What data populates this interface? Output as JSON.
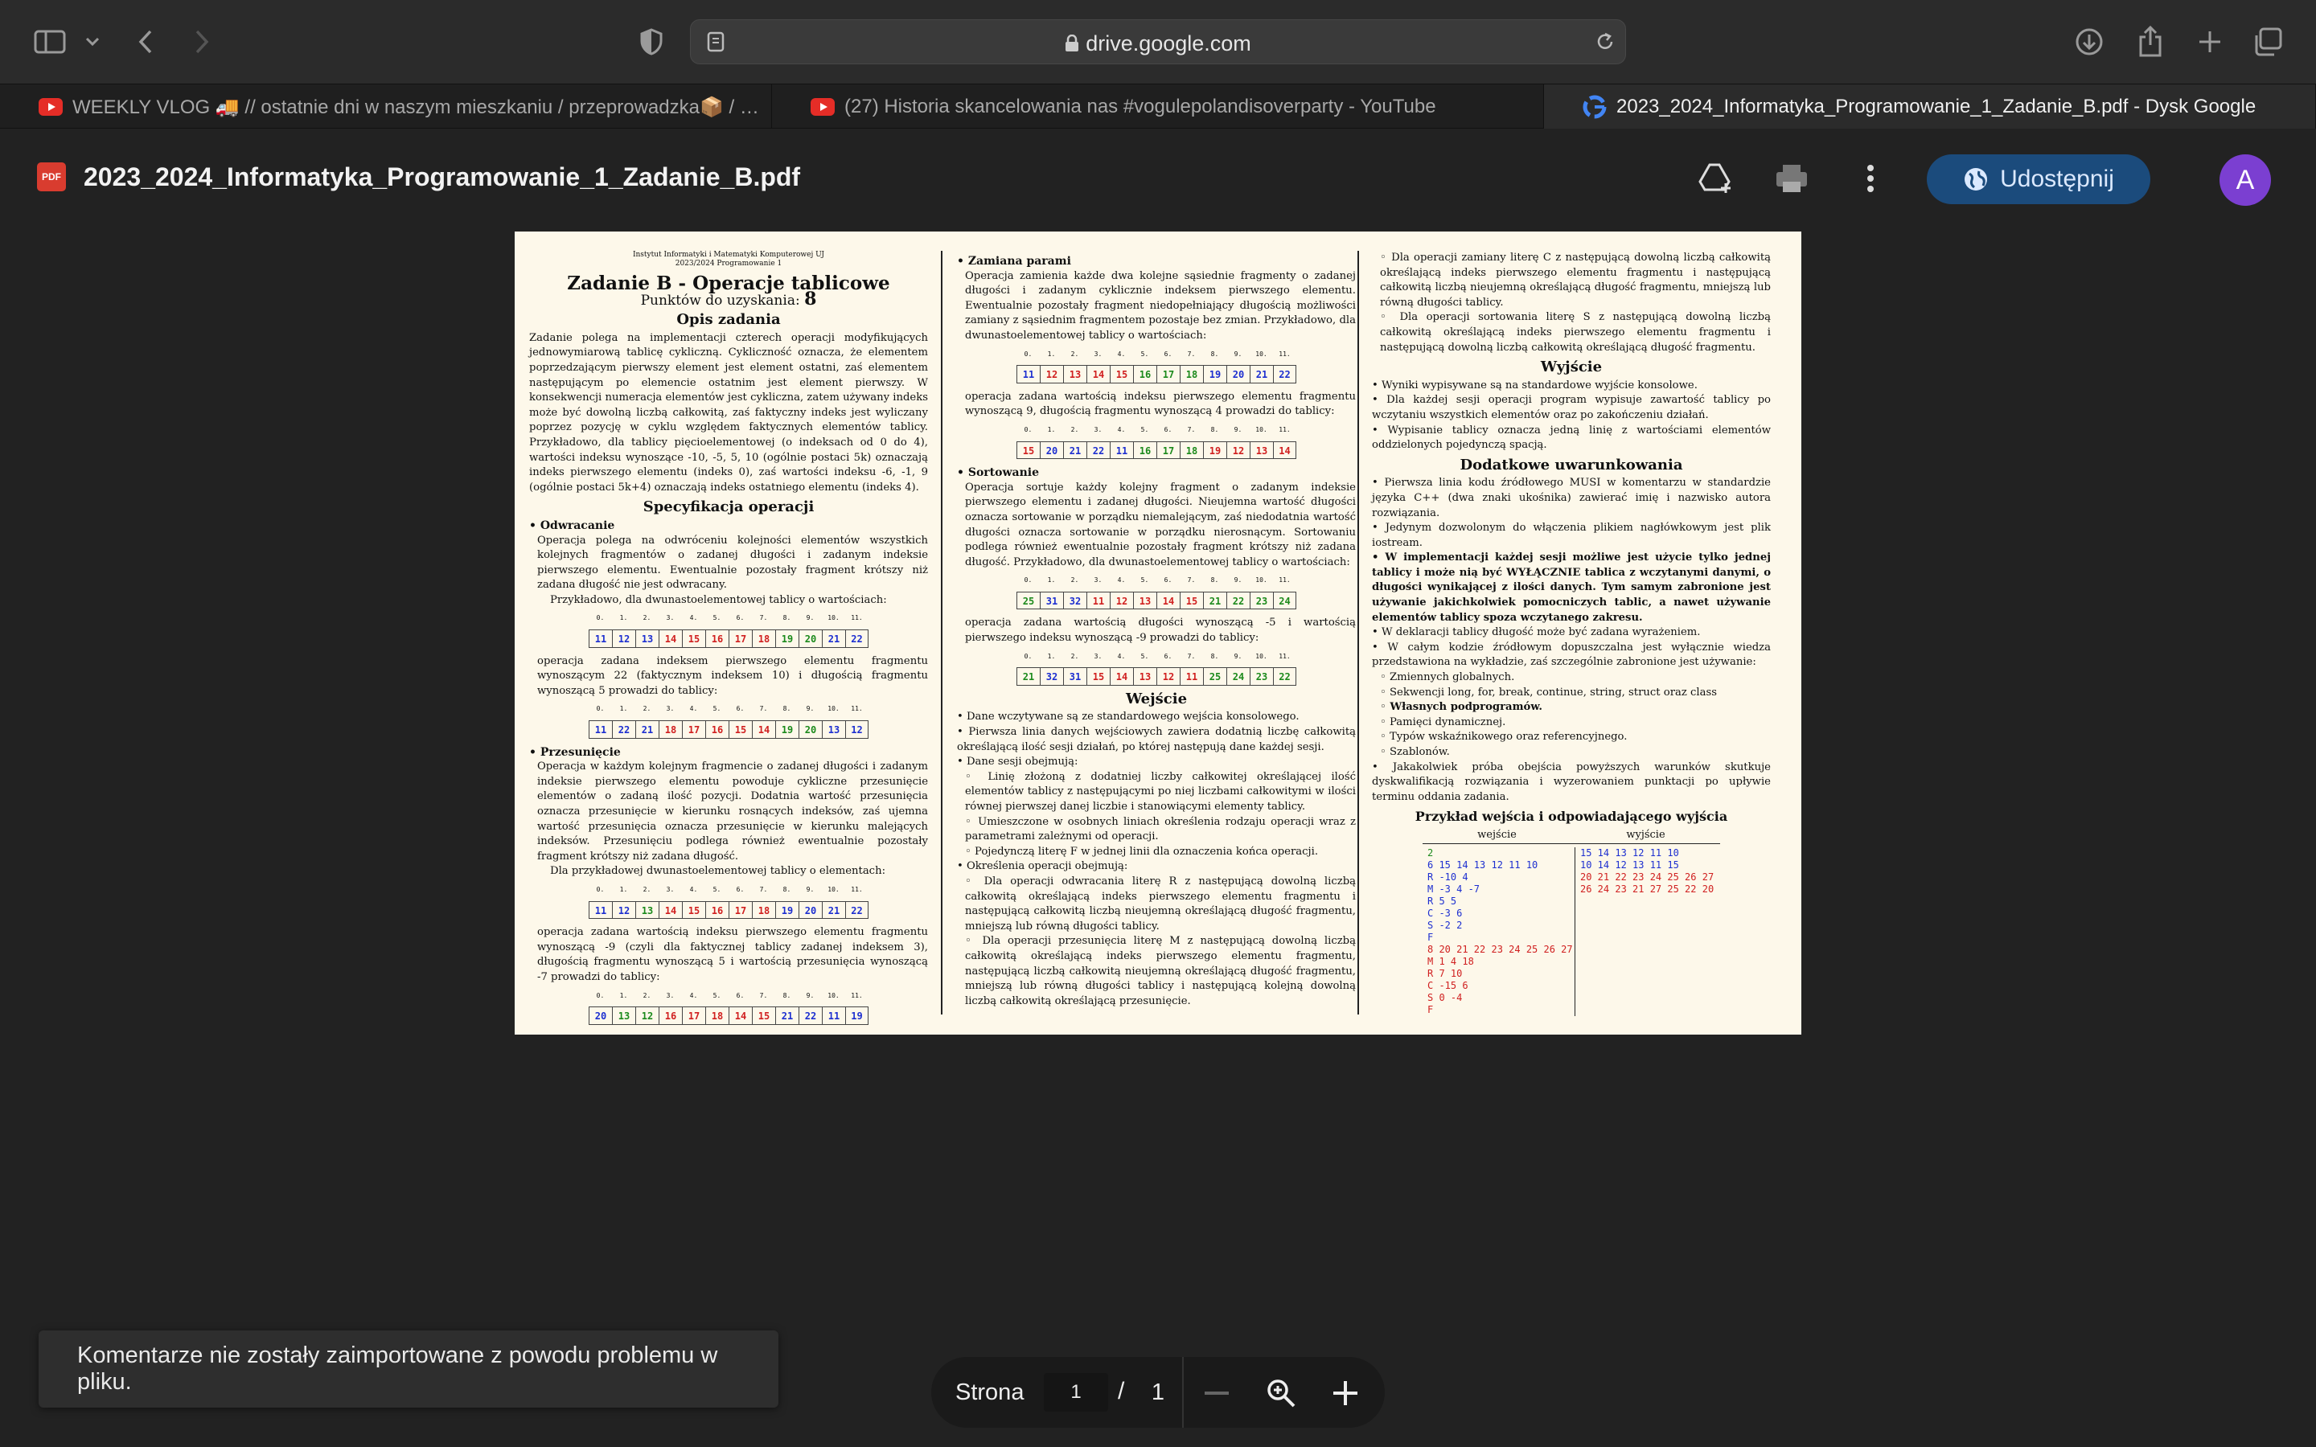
{
  "browser": {
    "url": "drive.google.com",
    "tabs": [
      {
        "label": "WEEKLY VLOG 🚚 // ostatnie dni w naszym mieszkaniu / przeprowadzka📦 / z...",
        "site": "youtube"
      },
      {
        "label": "(27) Historia skancelowania nas #vogulepolandisoverparty - YouTube",
        "site": "youtube"
      },
      {
        "label": "2023_2024_Informatyka_Programowanie_1_Zadanie_B.pdf - Dysk Google",
        "site": "google"
      }
    ]
  },
  "header": {
    "file_badge": "PDF",
    "title": "2023_2024_Informatyka_Programowanie_1_Zadanie_B.pdf",
    "share_label": "Udostępnij",
    "avatar_letter": "A"
  },
  "doc": {
    "institute": "Instytut Informatyki i Matematyki Komputerowej UJ",
    "course": "2023/2024 Programowanie 1",
    "title": "Zadanie B - Operacje tablicowe",
    "points_label": "Punktów do uzyskania:",
    "points_value": "8",
    "sec_opis": "Opis zadania",
    "opis": "Zadanie polega na implementacji czterech operacji modyfikujących jednowymiarową tablicę cykliczną. Cykliczność oznacza, że elementem poprzedzającym pierwszy element jest element ostatni, zaś elementem następującym po elemencie ostatnim jest element pierwszy. W konsekwencji numeracja elementów jest cykliczna, zatem używany indeks może być dowolną liczbą całkowitą, zaś faktyczny indeks jest wyliczany poprzez pozycję w cyklu względem faktycznych elementów tablicy. Przykładowo, dla tablicy pięcioelementowej (o indeksach od 0 do 4), wartości indeksu wynoszące -10, -5, 5, 10 (ogólnie postaci 5k) oznaczają indeks pierwszego elementu (indeks 0), zaś wartości indeksu -6, -1, 9 (ogólnie postaci 5k+4) oznaczają indeks ostatniego elementu (indeks 4).",
    "sec_spec": "Specyfikacja operacji",
    "odw_head": "Odwracanie",
    "odw_text": "Operacja polega na odwróceniu kolejności elementów wszystkich kolejnych fragmentów o zadanej długości i zadanym indeksie pierwszego elementu. Ewentualnie pozostały fragment krótszy niż zadana długość nie jest odwracany.",
    "odw_ex": "Przykładowo, dla dwunastoelementowej tablicy o wartościach:",
    "odw_after": "operacja zadana indeksem pierwszego elementu fragmentu wynoszącym 22 (faktycznym indeksem 10) i długością fragmentu wynoszącą 5 prowadzi do tablicy:",
    "prz_head": "Przesunięcie",
    "prz_text": "Operacja w każdym kolejnym fragmencie o zadanej długości i zadanym indeksie pierwszego elementu powoduje cykliczne przesunięcie elementów o zadaną ilość pozycji. Dodatnia wartość przesunięcia oznacza przesunięcie w kierunku rosnących indeksów, zaś ujemna wartość przesunięcia oznacza przesunięcie w kierunku malejących indeksów. Przesunięciu podlega również ewentualnie pozostały fragment krótszy niż zadana długość.",
    "prz_ex": "Dla przykładowej dwunastoelementowej tablicy o elementach:",
    "prz_after": "operacja zadana wartością indeksu pierwszego elementu fragmentu wynoszącą -9 (czyli dla faktycznej tablicy zadanej indeksem 3), długością fragmentu wynoszącą 5 i wartością przesunięcia wynoszącą -7 prowadzi do tablicy:",
    "zam_head": "Zamiana parami",
    "zam_text": "Operacja zamienia każde dwa kolejne sąsiednie fragmenty o zadanej długości i zadanym cyklicznie indeksem pierwszego elementu. Ewentualnie pozostały fragment niedopełniający długością możliwości zamiany z sąsiednim fragmentem pozostaje bez zmian. Przykładowo, dla dwunastoelementowej tablicy o wartościach:",
    "zam_after": "operacja zadana wartością indeksu pierwszego elementu fragmentu wynoszącą 9, długością fragmentu wynoszącą 4 prowadzi do tablicy:",
    "sor_head": "Sortowanie",
    "sor_text": "Operacja sortuje każdy kolejny fragment o zadanym indeksie pierwszego elementu i zadanej długości. Nieujemna wartość długości oznacza sortowanie w porządku niemalejącym, zaś niedodatnia wartość długości oznacza sortowanie w porządku nierosnącym. Sortowaniu podlega również ewentualnie pozostały fragment krótszy niż zadana długość. Przykładowo, dla dwunastoelementowej tablicy o wartościach:",
    "sor_after": "operacja zadana wartością długości wynoszącą -5 i wartością pierwszego indeksu wynoszącą -9 prowadzi do tablicy:",
    "sec_wejscie": "Wejście",
    "wej1": "Dane wczytywane są ze standardowego wejścia konsolowego.",
    "wej2": "Pierwsza linia danych wejściowych zawiera dodatnią liczbę całkowitą określającą ilość sesji działań, po której następują dane każdej sesji.",
    "wej3": "Dane sesji obejmują:",
    "wej3a": "Linię złożoną z dodatniej liczby całkowitej określającej ilość elementów tablicy z następującymi po niej liczbami całkowitymi w ilości równej pierwszej danej liczbie i stanowiącymi elementy tablicy.",
    "wej3b": "Umieszczone w osobnych liniach określenia rodzaju operacji wraz z parametrami zależnymi od operacji.",
    "wej3c": "Pojedynczą literę F w jednej linii dla oznaczenia końca operacji.",
    "wej4": "Określenia operacji obejmują:",
    "wej4a": "Dla operacji odwracania literę R z następującą dowolną liczbą całkowitą określającą indeks pierwszego elementu fragmentu i następującą całkowitą liczbą nieujemną określającą długość fragmentu, mniejszą lub równą długości tablicy.",
    "wej4b": "Dla operacji przesunięcia literę M z następującą dowolną liczbą całkowitą określającą indeks pierwszego elementu fragmentu, następującą liczbą całkowitą nieujemną określającą długość fragmentu, mniejszą lub równą długości tablicy i następującą kolejną dowolną liczbą całkowitą określającą przesunięcie.",
    "wej4c": "Dla operacji zamiany literę C z następującą dowolną liczbą całkowitą określającą indeks pierwszego elementu fragmentu i następującą całkowitą liczbą nieujemną określającą długość fragmentu, mniejszą lub równą długości tablicy.",
    "wej4d": "Dla operacji sortowania literę S z następującą dowolną liczbą całkowitą określającą indeks pierwszego elementu fragmentu i następującą dowolną liczbą całkowitą określającą długość fragmentu.",
    "sec_wyjscie": "Wyjście",
    "wyj1": "Wyniki wypisywane są na standardowe wyjście konsolowe.",
    "wyj2": "Dla każdej sesji operacji program wypisuje zawartość tablicy po wczytaniu wszystkich elementów oraz po zakończeniu działań.",
    "wyj3": "Wypisanie tablicy oznacza jedną linię z wartościami elementów oddzielonych pojedynczą spacją.",
    "sec_dod": "Dodatkowe uwarunkowania",
    "dod1": "Pierwsza linia kodu źródłowego MUSI w komentarzu w standardzie języka C++ (dwa znaki ukośnika) zawierać imię i nazwisko autora rozwiązania.",
    "dod2": "Jedynym dozwolonym do włączenia plikiem nagłówkowym jest plik iostream.",
    "dod3": "W implementacji każdej sesji możliwe jest użycie tylko jednej tablicy i może nią być WYŁĄCZNIE tablica z wczytanymi danymi, o długości wynikającej z ilości danych. Tym samym zabronione jest używanie jakichkolwiek pomocniczych tablic, a nawet używanie elementów tablicy spoza wczytanego zakresu.",
    "dod4": "W deklaracji tablicy długość może być zadana wyrażeniem.",
    "dod5": "W całym kodzie źródłowym dopuszczalna jest wyłącznie wiedza przedstawiona na wykładzie, zaś szczególnie zabronione jest używanie:",
    "dod5a": "Zmiennych globalnych.",
    "dod5b": "Sekwencji long, for, break, continue, string, struct oraz class",
    "dod5c": "Własnych podprogramów.",
    "dod5d": "Pamięci dynamicznej.",
    "dod5e": "Typów wskaźnikowego oraz referencyjnego.",
    "dod5f": "Szablonów.",
    "dod6": "Jakakolwiek próba obejścia powyższych warunków skutkuje dyskwalifikacją rozwiązania i wyzerowaniem punktacji po upływie terminu oddania zadania.",
    "sec_przyklad": "Przykład wejścia i odpowiadającego wyjścia",
    "io_in_head": "wejście",
    "io_out_head": "wyjście",
    "io_in": [
      "2",
      "6 15 14 13 12 11 10",
      "R -10 4",
      "M -3 4 -7",
      "R 5 5",
      "C -3 6",
      "S -2 2",
      "F",
      "8 20 21 22 23 24 25 26 27",
      "M 1 4 18",
      "R 7 10",
      "C -15 6",
      "S 0 -4",
      "F"
    ],
    "io_out": [
      "15 14 13 12 11 10",
      "10 14 12 13 11 15",
      "20 21 22 23 24 25 26 27",
      "26 24 23 21 27 25 22 20"
    ]
  },
  "arrays": {
    "odw_before": [
      "11",
      "12",
      "13",
      "14",
      "15",
      "16",
      "17",
      "18",
      "19",
      "20",
      "21",
      "22"
    ],
    "odw_after": [
      "11",
      "22",
      "21",
      "18",
      "17",
      "16",
      "15",
      "14",
      "19",
      "20",
      "13",
      "12"
    ],
    "prz_before": [
      "11",
      "12",
      "13",
      "14",
      "15",
      "16",
      "17",
      "18",
      "19",
      "20",
      "21",
      "22"
    ],
    "prz_after": [
      "20",
      "13",
      "12",
      "16",
      "17",
      "18",
      "14",
      "15",
      "21",
      "22",
      "11",
      "19"
    ],
    "zam_before": [
      "11",
      "12",
      "13",
      "14",
      "15",
      "16",
      "17",
      "18",
      "19",
      "20",
      "21",
      "22"
    ],
    "zam_after": [
      "15",
      "20",
      "21",
      "22",
      "11",
      "16",
      "17",
      "18",
      "19",
      "12",
      "13",
      "14"
    ],
    "sor_before": [
      "25",
      "31",
      "32",
      "11",
      "12",
      "13",
      "14",
      "15",
      "21",
      "22",
      "23",
      "24"
    ],
    "sor_after": [
      "21",
      "32",
      "31",
      "15",
      "14",
      "13",
      "12",
      "11",
      "25",
      "24",
      "23",
      "22"
    ]
  },
  "toast": "Komentarze nie zostały zaimportowane z powodu problemu w pliku.",
  "pager": {
    "label": "Strona",
    "current": "1",
    "separator": "/",
    "total": "1"
  }
}
